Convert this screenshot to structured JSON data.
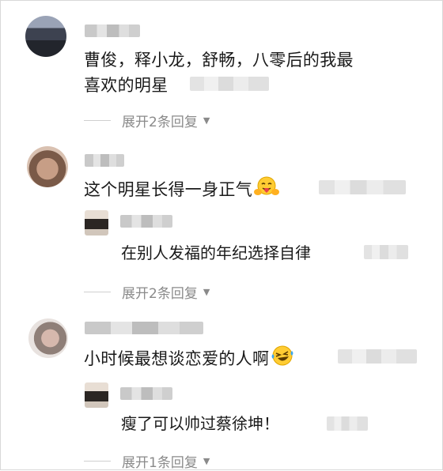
{
  "comments": [
    {
      "text_line1": "曹俊，释小龙，舒畅，八零后的我最",
      "text_line2": "喜欢的明星",
      "expand_label": "展开2条回复",
      "expand_icon": "chevron-down-icon"
    },
    {
      "text": "这个明星长得一身正气",
      "emoji_icon": "hugging-face-icon",
      "reply": {
        "text": "在别人发福的年纪选择自律"
      },
      "expand_label": "展开2条回复",
      "expand_icon": "chevron-down-icon"
    },
    {
      "text": "小时候最想谈恋爱的人啊",
      "emoji_icon": "laughing-crying-face-icon",
      "reply": {
        "text": "瘦了可以帅过蔡徐坤！"
      },
      "expand_label": "展开1条回复",
      "expand_icon": "chevron-down-icon"
    }
  ]
}
